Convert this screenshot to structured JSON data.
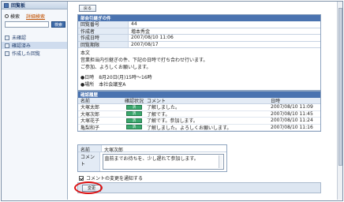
{
  "sidebar": {
    "title": "回覧板",
    "search_label": "検索",
    "advanced_search": "詳細検索",
    "search_button": "検索",
    "items": [
      {
        "label": "未確認"
      },
      {
        "label": "確認済み"
      },
      {
        "label": "作成した回覧"
      }
    ]
  },
  "main": {
    "back_button": "戻る",
    "notice": {
      "title": "部会引継ぎの件",
      "fields": [
        {
          "key": "回覧番号",
          "value": "44"
        },
        {
          "key": "作成者",
          "value": "増本秀金"
        },
        {
          "key": "作成日時",
          "value": "2007/08/10 11:06"
        },
        {
          "key": "回覧期限",
          "value": "2007/08/17"
        }
      ],
      "body_label": "本文",
      "body_lines": [
        "営業担当内引継ぎの件、下記の日時で打ち合わせ行います。",
        "ご参加、よろしくお願いします。",
        "",
        "●日時　8月20日(月)15時〜16時",
        "●場所　本社会議室A"
      ]
    },
    "confirm": {
      "title": "確認履歴",
      "headers": [
        "名前",
        "確認状況",
        "コメント",
        "日時"
      ],
      "rows": [
        {
          "name": "大塚太郎",
          "status": "済",
          "comment": "了解しました。",
          "date": "2007/08/10 11:09"
        },
        {
          "name": "大塚次郎",
          "status": "済",
          "comment": "了解です。",
          "date": "2007/08/10 11:45"
        },
        {
          "name": "大塚花子",
          "status": "済",
          "comment": "了解です。参加します。",
          "date": "2007/08/10 11:24"
        },
        {
          "name": "亀梨和子",
          "status": "済",
          "comment": "了解しました。よろしくお願いします。",
          "date": "2007/08/10 11:16"
        }
      ]
    },
    "my_comment": {
      "name_key": "名前",
      "name_value": "大塚次郎",
      "comment_key": "コメント",
      "comment_value": "直前までお待ちを、少し遅れて参加します。"
    },
    "notify_label": "コメントの変更を通知する",
    "change_button": "変更"
  }
}
